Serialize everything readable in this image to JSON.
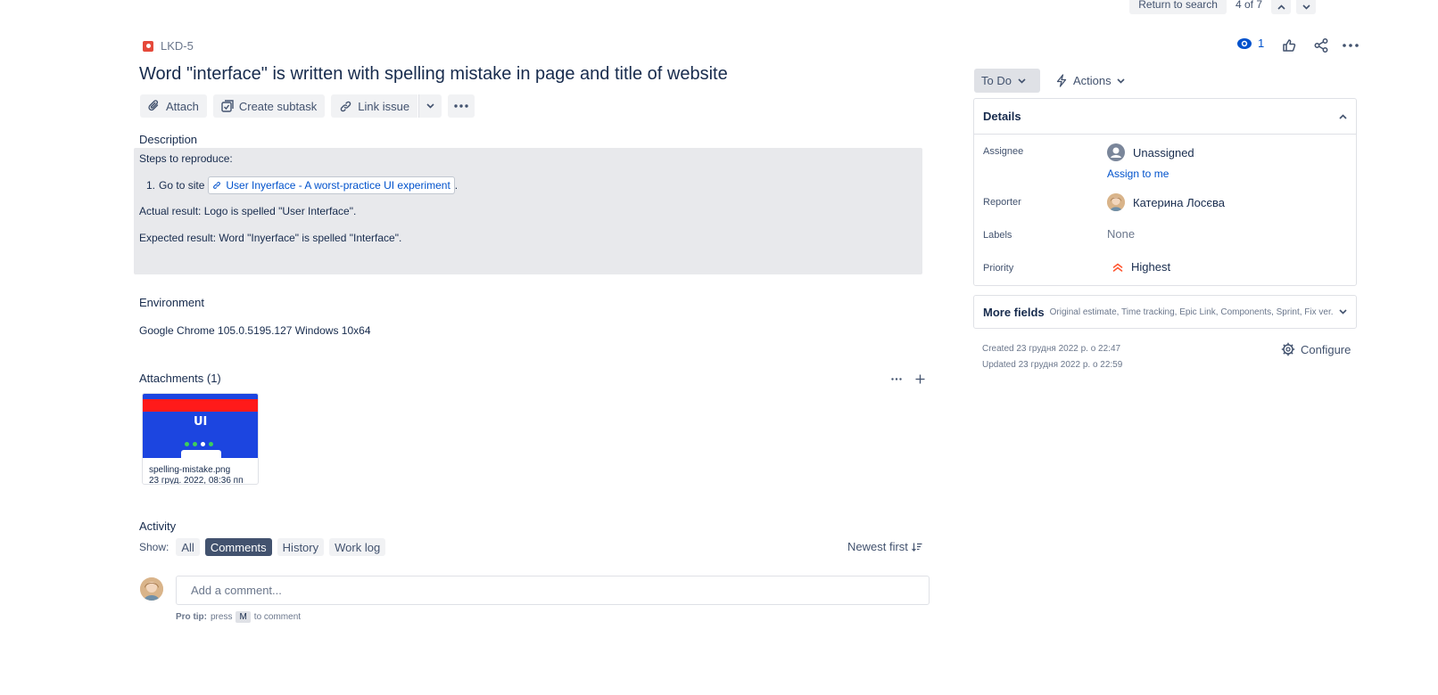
{
  "topnav": {
    "return_label": "Return to search",
    "count": "4 of 7"
  },
  "issue": {
    "key": "LKD-5",
    "summary": "Word \"interface\" is written with spelling mistake in page and title of website",
    "watchers": "1"
  },
  "toolbar": {
    "attach": "Attach",
    "create_subtask": "Create subtask",
    "link_issue": "Link issue"
  },
  "description": {
    "label": "Description",
    "steps_title": "Steps to reproduce:",
    "step_num": "1.",
    "step_text": "Go to site",
    "link_text": "User Inyerface - A worst-practice UI experiment",
    "link_trailer": ".",
    "actual": "Actual result: Logo is spelled  \"User Interface\".",
    "expected": "Expected result: Word \"Inyerface\" is spelled \"Interface\"."
  },
  "environment": {
    "label": "Environment",
    "value": "Google Chrome 105.0.5195.127 Windows 10x64"
  },
  "attachments": {
    "label": "Attachments (1)",
    "items": [
      {
        "name": "spelling-mistake.png",
        "date": "23 груд. 2022, 08:36 пп",
        "thumb_text": "UI"
      }
    ]
  },
  "activity": {
    "label": "Activity",
    "show_label": "Show:",
    "filters": [
      "All",
      "Comments",
      "History",
      "Work log"
    ],
    "active_filter": "Comments",
    "sort": "Newest first",
    "comment_placeholder": "Add a comment...",
    "protip_label": "Pro tip:",
    "protip_press": "press",
    "protip_key": "M",
    "protip_to": "to comment"
  },
  "sidebar": {
    "status": "To Do",
    "actions": "Actions",
    "details": {
      "title": "Details",
      "assignee_label": "Assignee",
      "assignee_value": "Unassigned",
      "assign_to_me": "Assign to me",
      "reporter_label": "Reporter",
      "reporter_value": "Катерина Лосєва",
      "labels_label": "Labels",
      "labels_value": "None",
      "priority_label": "Priority",
      "priority_value": "Highest"
    },
    "more_fields": {
      "title": "More fields",
      "desc": "Original estimate, Time tracking, Epic Link, Components, Sprint, Fix ver..."
    },
    "created": "Created 23 грудня 2022 р. о 22:47",
    "updated": "Updated 23 грудня 2022 р. о 22:59",
    "configure": "Configure"
  },
  "colors": {
    "link": "#0052cc",
    "priority_highest": "#ff5630",
    "bug": "#e5493a",
    "active_filter_bg": "#42526e"
  },
  "icons": [
    "eye-icon",
    "like-icon",
    "share-icon",
    "more-icon",
    "paperclip-icon",
    "subtask-icon",
    "link-icon",
    "lightning-icon",
    "gear-icon",
    "plus-icon",
    "sort-icon"
  ]
}
